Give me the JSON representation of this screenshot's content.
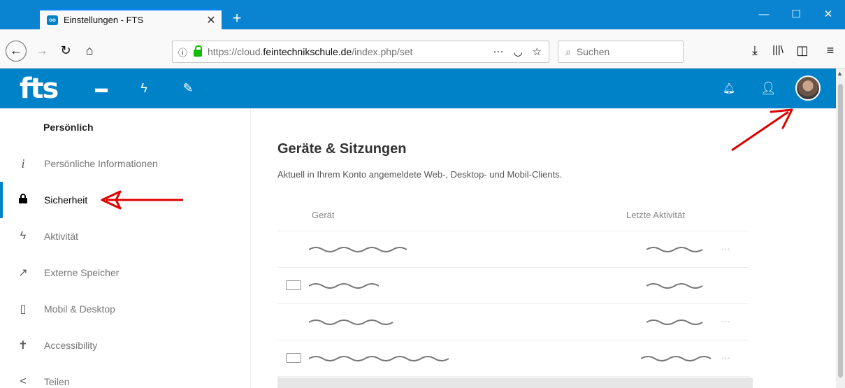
{
  "browser": {
    "tab_title": "Einstellungen - FTS",
    "tab_close": "✕",
    "new_tab": "+",
    "url_proto": "https://cloud.",
    "url_host": "feintechnikschule.de",
    "url_path": "/index.php/set",
    "search_placeholder": "Suchen",
    "window_controls": {
      "minimize": "—",
      "maximize": "☐",
      "close": "✕"
    }
  },
  "header": {
    "logo": "fts",
    "nav_icons": [
      "files-icon",
      "activity-icon",
      "notes-icon"
    ],
    "right_icons": [
      "notifications-icon",
      "contacts-icon"
    ]
  },
  "sidebar": {
    "heading": "Persönlich",
    "items": [
      {
        "label": "Persönliche Informationen",
        "icon": "info-icon",
        "glyph": "i"
      },
      {
        "label": "Sicherheit",
        "icon": "lock-icon",
        "glyph": "🔒",
        "active": true
      },
      {
        "label": "Aktivität",
        "icon": "activity-icon",
        "glyph": "ϟ"
      },
      {
        "label": "Externe Speicher",
        "icon": "external-storage-icon",
        "glyph": "↗"
      },
      {
        "label": "Mobil & Desktop",
        "icon": "phone-icon",
        "glyph": "▯"
      },
      {
        "label": "Accessibility",
        "icon": "accessibility-icon",
        "glyph": "✝"
      },
      {
        "label": "Teilen",
        "icon": "share-icon",
        "glyph": "<"
      }
    ]
  },
  "main": {
    "title": "Geräte & Sitzungen",
    "description": "Aktuell in Ihrem Konto angemeldete Web-, Desktop- und Mobil-Clients.",
    "columns": {
      "device": "Gerät",
      "activity": "Letzte Aktivität"
    },
    "more_label": "···"
  },
  "colors": {
    "brand": "#0082c9",
    "annotation": "#e00000"
  }
}
